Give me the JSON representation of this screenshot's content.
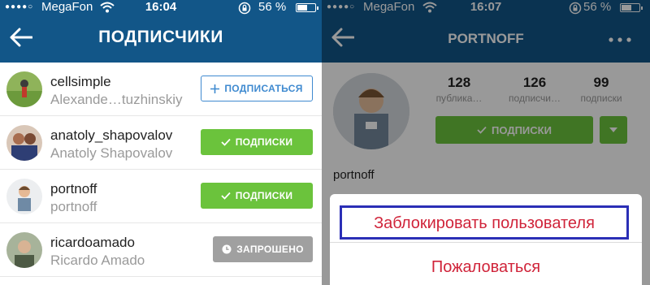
{
  "left_screen": {
    "status": {
      "signal": "●●●●○",
      "carrier": "MegaFon",
      "time": "16:04",
      "battery": "56 %",
      "battery_level": 0.56
    },
    "nav": {
      "title": "ПОДПИСЧИКИ"
    },
    "followers": [
      {
        "username": "cellsimple",
        "full_name": "Alexande…tuzhinskiy",
        "action": "ПОДПИСАТЬСЯ",
        "state": "follow"
      },
      {
        "username": "anatoly_shapovalov",
        "full_name": "Anatoly Shapovalov",
        "action": "ПОДПИСКИ",
        "state": "following"
      },
      {
        "username": "portnoff",
        "full_name": "portnoff",
        "action": "ПОДПИСКИ",
        "state": "following"
      },
      {
        "username": "ricardoamado",
        "full_name": "Ricardo Amado",
        "action": "ЗАПРОШЕНО",
        "state": "requested"
      }
    ]
  },
  "right_screen": {
    "status": {
      "signal": "●●●●○",
      "carrier": "MegaFon",
      "time": "16:07",
      "battery": "56 %",
      "battery_level": 0.56
    },
    "nav": {
      "title": "PORTNOFF"
    },
    "profile": {
      "name": "portnoff",
      "stats": [
        {
          "value": "128",
          "label": "публика…"
        },
        {
          "value": "126",
          "label": "подписчи…"
        },
        {
          "value": "99",
          "label": "подписки"
        }
      ],
      "follow_label": "ПОДПИСКИ"
    },
    "action_sheet": {
      "block_label": "Заблокировать пользователя",
      "report_label": "Пожаловаться"
    }
  },
  "colors": {
    "nav_bg": "#125688",
    "follow_blue": "#3f8ad0",
    "following_green": "#6bc33c",
    "requested_gray": "#a0a0a0",
    "destructive_red": "#d0243a",
    "highlight_frame": "#2b2fb6"
  },
  "icons": [
    "back-arrow-icon",
    "plus-icon",
    "checkmark-icon",
    "clock-icon",
    "wifi-icon",
    "rotation-lock-icon",
    "battery-icon",
    "more-dots-icon",
    "chevron-down-icon"
  ]
}
